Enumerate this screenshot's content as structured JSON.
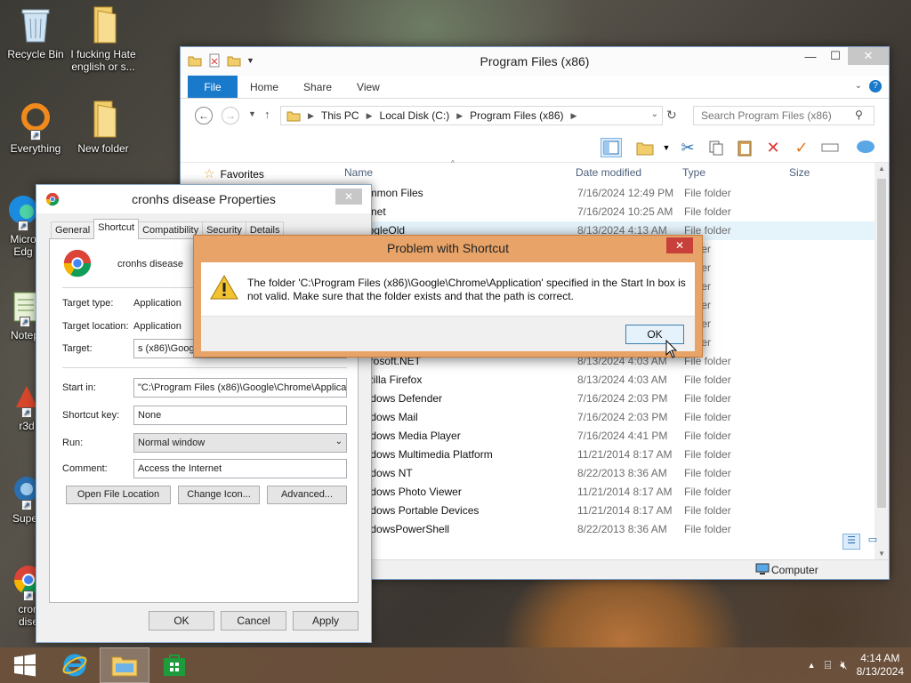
{
  "desktop": {
    "icons": [
      {
        "label": "Recycle Bin"
      },
      {
        "label": "I fucking Hate english or s..."
      },
      {
        "label": "Everything"
      },
      {
        "label": "New folder"
      },
      {
        "label": "Micro Edg"
      },
      {
        "label": "Notep"
      },
      {
        "label": "r3d"
      },
      {
        "label": "Super"
      },
      {
        "label": "cron dise"
      }
    ]
  },
  "explorer": {
    "title": "Program Files (x86)",
    "ribbon_tabs": [
      "File",
      "Home",
      "Share",
      "View"
    ],
    "breadcrumb": [
      "This PC",
      "Local Disk (C:)",
      "Program Files (x86)"
    ],
    "search_placeholder": "Search Program Files (x86)",
    "nav": {
      "favorites": "Favorites"
    },
    "columns": {
      "name": "Name",
      "date": "Date modified",
      "type": "Type",
      "size": "Size"
    },
    "rows": [
      {
        "name": "ommon Files",
        "date": "7/16/2024 12:49 PM",
        "type": "File folder"
      },
      {
        "name": "otnet",
        "date": "7/16/2024 10:25 AM",
        "type": "File folder"
      },
      {
        "name": "oogleOld",
        "date": "8/13/2024 4:13 AM",
        "type": "File folder"
      },
      {
        "name": "",
        "date": "",
        "type": "folder"
      },
      {
        "name": "",
        "date": "",
        "type": "folder"
      },
      {
        "name": "",
        "date": "",
        "type": "folder"
      },
      {
        "name": "",
        "date": "",
        "type": "folder"
      },
      {
        "name": "",
        "date": "",
        "type": "folder"
      },
      {
        "name": "",
        "date": "",
        "type": "folder"
      },
      {
        "name": "icrosoft.NET",
        "date": "8/13/2024 4:03 AM",
        "type": "File folder"
      },
      {
        "name": "ozilla Firefox",
        "date": "8/13/2024 4:03 AM",
        "type": "File folder"
      },
      {
        "name": "indows Defender",
        "date": "7/16/2024 2:03 PM",
        "type": "File folder"
      },
      {
        "name": "indows Mail",
        "date": "7/16/2024 2:03 PM",
        "type": "File folder"
      },
      {
        "name": "indows Media Player",
        "date": "7/16/2024 4:41 PM",
        "type": "File folder"
      },
      {
        "name": "indows Multimedia Platform",
        "date": "11/21/2014 8:17 AM",
        "type": "File folder"
      },
      {
        "name": "indows NT",
        "date": "8/22/2013 8:36 AM",
        "type": "File folder"
      },
      {
        "name": "indows Photo Viewer",
        "date": "11/21/2014 8:17 AM",
        "type": "File folder"
      },
      {
        "name": "indows Portable Devices",
        "date": "11/21/2014 8:17 AM",
        "type": "File folder"
      },
      {
        "name": "indowsPowerShell",
        "date": "8/22/2013 8:36 AM",
        "type": "File folder"
      }
    ],
    "status": {
      "computer": "Computer"
    }
  },
  "properties": {
    "title": "cronhs disease Properties",
    "tabs": [
      "General",
      "Shortcut",
      "Compatibility",
      "Security",
      "Details"
    ],
    "name": "cronhs disease",
    "target_type_label": "Target type:",
    "target_type": "Application",
    "target_location_label": "Target location:",
    "target_location": "Application",
    "target_label": "Target:",
    "target": "s (x86)\\Google\\",
    "start_in_label": "Start in:",
    "start_in": "\"C:\\Program Files (x86)\\Google\\Chrome\\Applicati",
    "shortcut_key_label": "Shortcut key:",
    "shortcut_key": "None",
    "run_label": "Run:",
    "run": "Normal window",
    "comment_label": "Comment:",
    "comment": "Access the Internet",
    "btn_open_location": "Open File Location",
    "btn_change_icon": "Change Icon...",
    "btn_advanced": "Advanced...",
    "btn_ok": "OK",
    "btn_cancel": "Cancel",
    "btn_apply": "Apply"
  },
  "error_dialog": {
    "title": "Problem with Shortcut",
    "message": "The folder 'C:\\Program Files (x86)\\Google\\Chrome\\Application' specified in the Start In box is not valid. Make sure that the folder exists and that the path is correct.",
    "ok": "OK"
  },
  "taskbar": {
    "time": "4:14 AM",
    "date": "8/13/2024"
  },
  "colors": {
    "accent": "#1979ca",
    "error_frame": "#e8a368",
    "taskbar": "#6e523c"
  }
}
